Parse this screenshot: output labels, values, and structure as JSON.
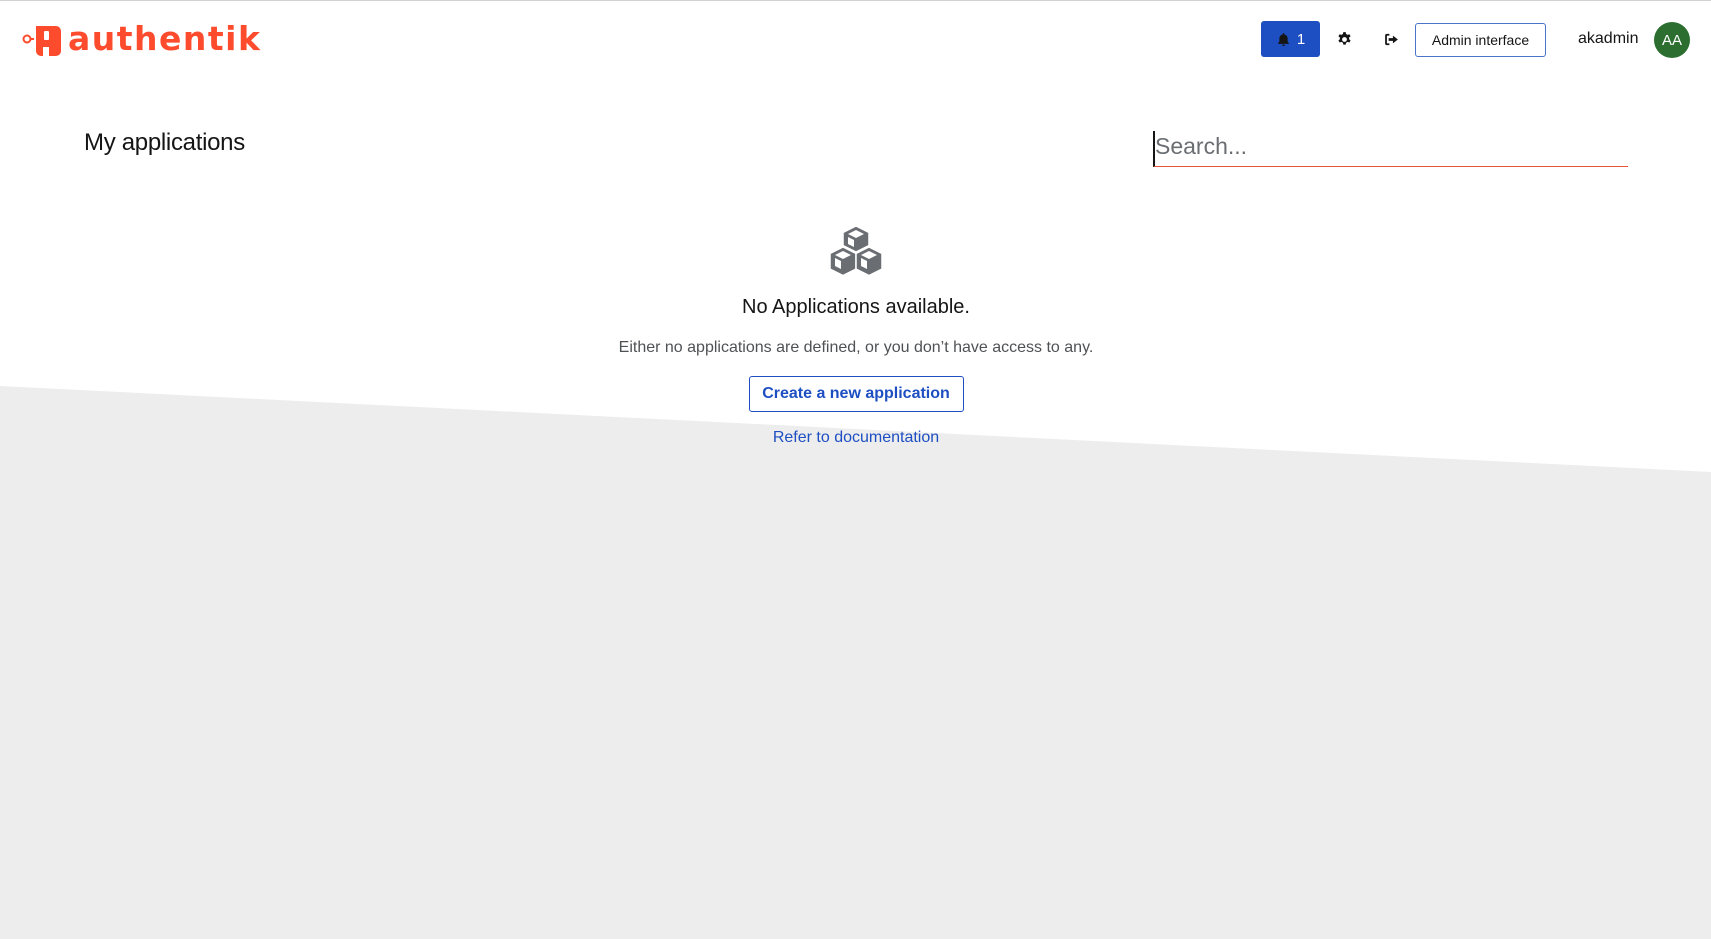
{
  "brand": {
    "logo_text": "authentik",
    "color": "#fd4b2d"
  },
  "header": {
    "notifications": {
      "count": "1",
      "icon": "bell-icon",
      "color": "#1e4fc2"
    },
    "settings_icon": "gear-icon",
    "logout_icon": "sign-out-icon",
    "admin_button_label": "Admin interface",
    "username": "akadmin",
    "avatar_initials": "AA",
    "avatar_color": "#2b6e2f"
  },
  "main": {
    "title": "My applications",
    "search": {
      "placeholder": "Search...",
      "value": ""
    },
    "empty_state": {
      "icon": "cubes-icon",
      "title": "No Applications available.",
      "body": "Either no applications are defined, or you don’t have access to any.",
      "create_button_label": "Create a new application",
      "doc_link_label": "Refer to documentation"
    }
  },
  "colors": {
    "background_lower": "#ededed",
    "accent": "#1e4fc2",
    "search_underline": "#e6543b"
  }
}
